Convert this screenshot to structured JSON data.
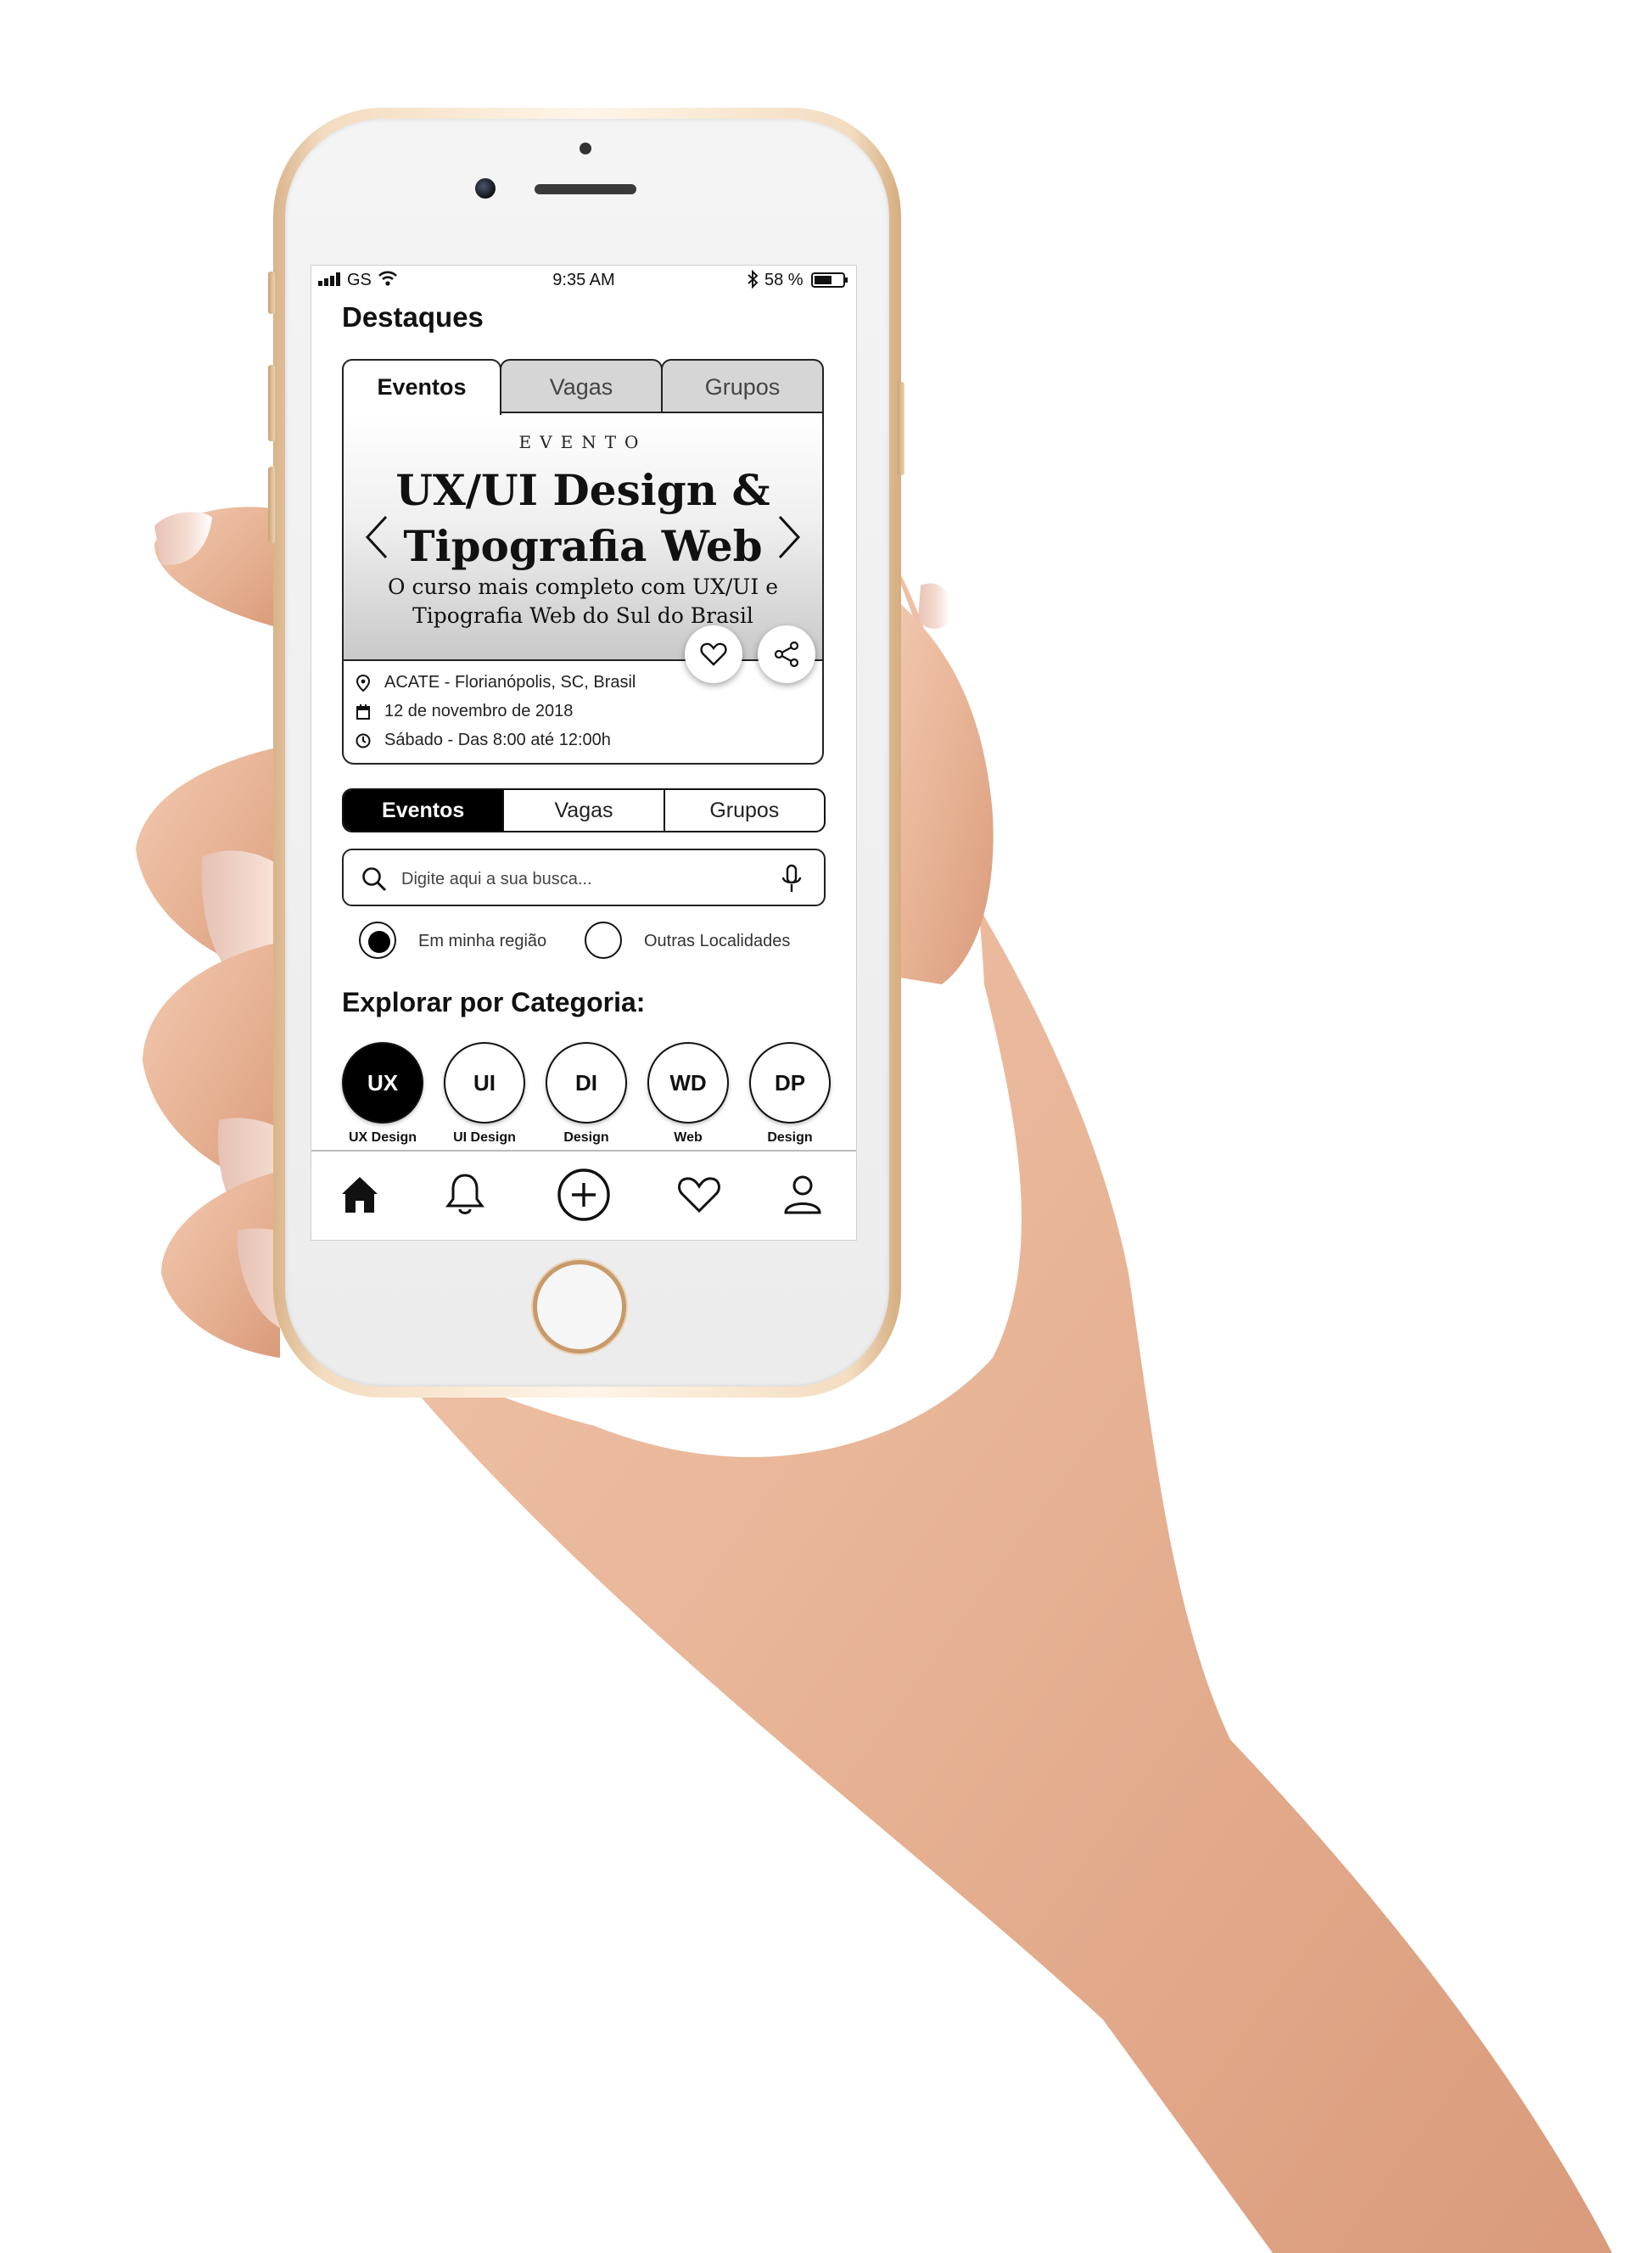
{
  "status_bar": {
    "carrier": "GS",
    "time": "9:35 AM",
    "battery": "58 %",
    "icons": [
      "signal-icon",
      "wifi-icon",
      "bluetooth-icon",
      "battery-icon"
    ]
  },
  "page": {
    "title": "Destaques"
  },
  "featured": {
    "tabs": [
      "Eventos",
      "Vagas",
      "Grupos"
    ],
    "active_tab": "Eventos",
    "kicker": "EVENTO",
    "headline_line1": "UX/UI Design &",
    "headline_line2": "Tipografia Web",
    "subtitle_line1": "O curso mais completo com UX/UI e",
    "subtitle_line2": "Tipografia Web do Sul do Brasil",
    "location": "ACATE - Florianópolis, SC, Brasil",
    "date": "12 de novembro de 2018",
    "time": "Sábado - Das 8:00 até 12:00h",
    "actions": [
      "heart-icon",
      "share-icon"
    ]
  },
  "filter_tabs": {
    "items": [
      "Eventos",
      "Vagas",
      "Grupos"
    ],
    "active": "Eventos"
  },
  "search": {
    "placeholder": "Digite aqui a sua busca...",
    "value": ""
  },
  "region": {
    "options": [
      "Em minha região",
      "Outras Localidades"
    ],
    "selected": "Em minha região"
  },
  "categories": {
    "title": "Explorar por Categoria:",
    "items": [
      {
        "code": "UX",
        "label": "UX Design"
      },
      {
        "code": "UI",
        "label": "UI Design"
      },
      {
        "code": "DI",
        "label": "Design"
      },
      {
        "code": "WD",
        "label": "Web"
      },
      {
        "code": "DP",
        "label": "Design"
      }
    ],
    "active": "UX"
  },
  "bottom_nav": {
    "items": [
      "home-icon",
      "bell-icon",
      "add-icon",
      "heart-icon",
      "profile-icon"
    ],
    "active": "home-icon"
  },
  "colors": {
    "accent": "#000000",
    "background": "#ffffff",
    "phone_frame": "#e8c9a5"
  }
}
